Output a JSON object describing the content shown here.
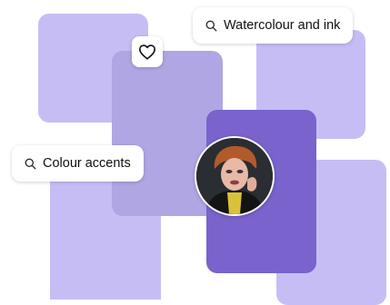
{
  "search_chips": {
    "watercolour": {
      "text": "Watercolour and ink",
      "icon": "search-icon"
    },
    "accents": {
      "text": "Colour accents",
      "icon": "search-icon"
    }
  },
  "favorite": {
    "icon": "heart-icon"
  },
  "avatar": {
    "description_icon": "profile-photo"
  },
  "colors": {
    "lavender": "#c7bdf5",
    "muted_violet": "#b0a6e3",
    "purple": "#7a63cc"
  }
}
